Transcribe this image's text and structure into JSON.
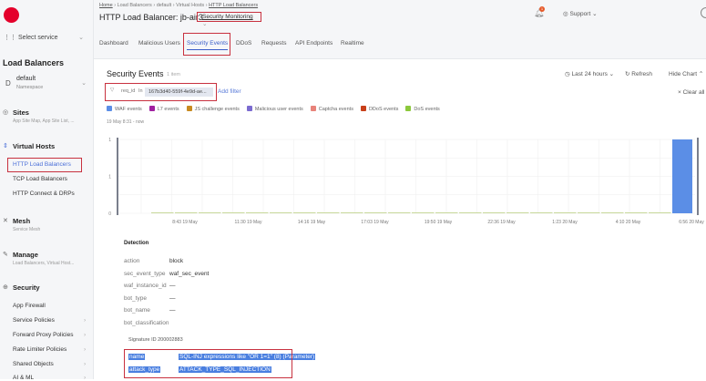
{
  "sidebar": {
    "logo": "f5",
    "select_service": "Select service",
    "section_title": "Load Balancers",
    "namespace": {
      "initial": "D",
      "name": "default",
      "label": "Namespace"
    },
    "sites": {
      "title": "Sites",
      "sub": "App Site Map, App Site List, ..."
    },
    "virtual_hosts": {
      "title": "Virtual Hosts",
      "items": [
        "HTTP Load Balancers",
        "TCP Load Balancers",
        "HTTP Connect & DRPs"
      ]
    },
    "mesh": {
      "title": "Mesh",
      "sub": "Service Mesh"
    },
    "manage": {
      "title": "Manage",
      "sub": "Load Balancers, Virtual Host..."
    },
    "security": {
      "title": "Security",
      "items": [
        "App Firewall",
        "Service Policies",
        "Forward Proxy Policies",
        "Rate Limiter Policies",
        "Shared Objects",
        "AI & ML"
      ]
    }
  },
  "header": {
    "breadcrumb": [
      "Home",
      "Load Balancers",
      "default",
      "Virtual Hosts",
      "HTTP Load Balancers"
    ],
    "title": "HTTP Load Balancer: jb-air3",
    "view": "Security Monitoring",
    "notifications": "1",
    "support": "Support",
    "tabs": [
      "Dashboard",
      "Malicious Users",
      "Security Events",
      "DDoS",
      "Requests",
      "API Endpoints",
      "Realtime"
    ]
  },
  "events": {
    "title": "Security Events",
    "count": "1 item",
    "time_range": "Last 24 hours",
    "refresh": "Refresh",
    "hide_chart": "Hide Chart",
    "clear_all": "Clear all",
    "filter": {
      "key": "req_id",
      "op": "In",
      "value": "167b3d40-559f-4e9d-ae..."
    },
    "add_filter": "Add filter",
    "legend": [
      {
        "label": "WAF events",
        "color": "#5b8ee6"
      },
      {
        "label": "L7 events",
        "color": "#a020a0"
      },
      {
        "label": "JS challenge events",
        "color": "#c88a20"
      },
      {
        "label": "Malicious user events",
        "color": "#7b6bd0"
      },
      {
        "label": "Captcha events",
        "color": "#e8837a"
      },
      {
        "label": "DDoS events",
        "color": "#c8401a"
      },
      {
        "label": "DoS events",
        "color": "#8cc83c"
      }
    ],
    "since": "19 May 8:31 - now"
  },
  "chart_data": {
    "type": "bar",
    "ylim": [
      0,
      1
    ],
    "yticks": [
      "1",
      "1",
      "0"
    ],
    "xticks": [
      "8:43 19 May",
      "11:30 19 May",
      "14:16 19 May",
      "17:03 19 May",
      "19:50 19 May",
      "22:36 19 May",
      "1:23 20 May",
      "4:10 20 May",
      "6:56 20 May"
    ],
    "values": [
      0,
      0,
      0,
      0,
      0,
      0,
      0,
      0,
      0,
      0,
      0,
      0,
      0,
      0,
      0,
      0,
      0,
      0,
      0,
      0,
      0,
      0,
      0,
      1
    ],
    "bar_color": "#5b8ee6",
    "zero_color": "#c8d89a"
  },
  "detection": {
    "title": "Detection",
    "rows": [
      [
        "action",
        "block"
      ],
      [
        "sec_event_type",
        "waf_sec_event"
      ],
      [
        "waf_instance_id",
        "—"
      ],
      [
        "bot_type",
        "—"
      ],
      [
        "bot_name",
        "—"
      ],
      [
        "bot_classification",
        ""
      ]
    ],
    "signature": "Signature ID 200002883",
    "sig_rows": [
      [
        "name",
        "SQL-INJ expressions like \"OR 1=1\" (8) (Parameter)"
      ],
      [
        "attack_type",
        "ATTACK_TYPE_SQL_INJECTION"
      ]
    ]
  }
}
